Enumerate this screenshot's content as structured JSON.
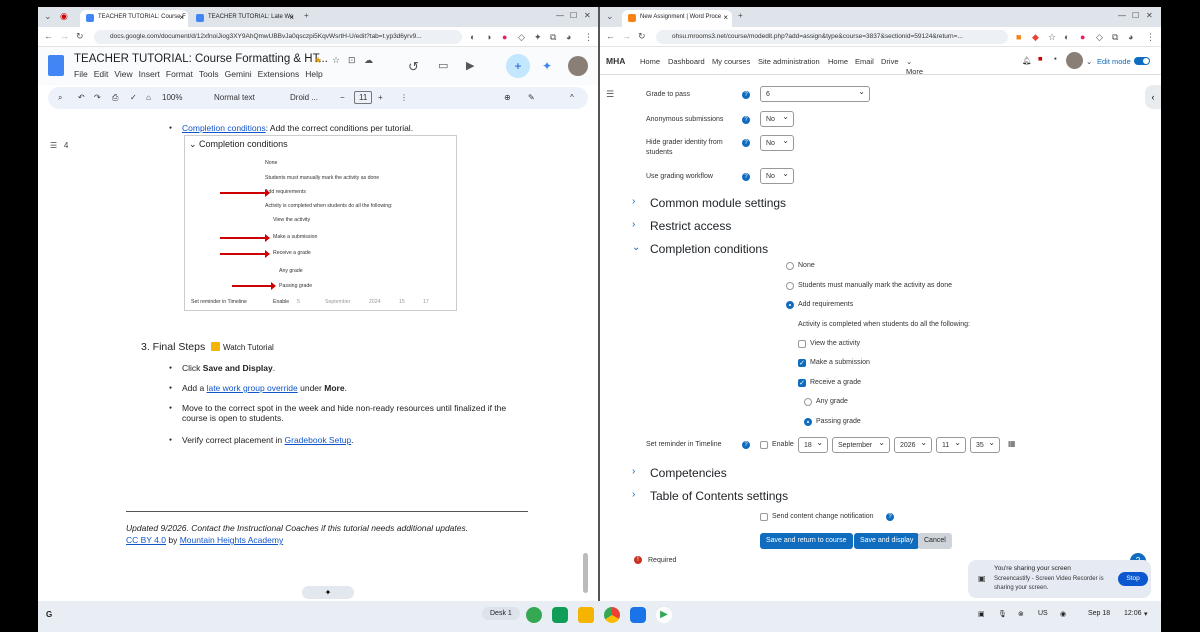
{
  "left_window": {
    "tabs": [
      "TEACHER TUTORIAL: Course F",
      "TEACHER TUTORIAL: Late Wo"
    ],
    "url": "docs.google.com/document/d/12xfnoiJiog3XY9AhQmwUBBvJa0qsczpi5KqvWsrtH-U/edit?tab=t.yp3d6yrv9...",
    "doc_title": "TEACHER TUTORIAL: Course Formatting & HT...",
    "menu": [
      "File",
      "Edit",
      "View",
      "Insert",
      "Format",
      "Tools",
      "Gemini",
      "Extensions",
      "Help"
    ],
    "toolbar": {
      "zoom": "100%",
      "style": "Normal text",
      "font": "Droid ...",
      "size": "11",
      "outline_count": "4"
    },
    "content": {
      "completion_link": "Completion conditions",
      "completion_text": ": Add the correct conditions per tutorial.",
      "shot": {
        "heading": "Completion conditions",
        "none": "None",
        "manual": "Students must manually mark the activity as done",
        "add": "Add requirements",
        "activity": "Activity is completed when students do all the following:",
        "view": "View the activity",
        "submit": "Make a submission",
        "grade": "Receive a grade",
        "any": "Any grade",
        "passing": "Passing grade",
        "reminder": "Set reminder in Timeline",
        "enable": "Enable",
        "d": "5",
        "m": "September",
        "y": "2024",
        "h": "15",
        "min": "17"
      },
      "step_heading": "3.  Final Steps",
      "watch": "Watch Tutorial",
      "b1_pre": "Click ",
      "b1_bold": "Save and Display",
      "b1_post": ".",
      "b2_pre": "Add a ",
      "b2_link": "late work group override",
      "b2_mid": " under ",
      "b2_bold": "More",
      "b2_post": ".",
      "b3_line1": "Move to the correct spot in the week and hide non-ready resources until finalized if the",
      "b3_line2": "course is open to students.",
      "b4_pre": "Verify correct placement in ",
      "b4_link": "Gradebook Setup",
      "b4_post": ".",
      "footer_italic": "Updated 9/2026. Contact the Instructional Coaches if this tutorial needs additional updates.",
      "footer_cc": "CC BY 4.0",
      "footer_by": " by ",
      "footer_org": "Mountain Heights Academy"
    }
  },
  "right_window": {
    "tab": "New Assignment | Word Proce",
    "url": "ohsu.mrooms3.net/course/modedit.php?add=assign&type&course=3837&sectionid=59124&return=...",
    "brand": "MHA",
    "nav": [
      "Home",
      "Dashboard",
      "My courses",
      "Site administration",
      "Home",
      "Email",
      "Drive",
      "More"
    ],
    "edit_mode": "Edit mode",
    "form": {
      "grade_to_pass_label": "Grade to pass",
      "grade_to_pass_value": "6",
      "anon_label": "Anonymous submissions",
      "anon_value": "No",
      "hide_label_1": "Hide grader identity from",
      "hide_label_2": "students",
      "hide_value": "No",
      "workflow_label": "Use grading workflow",
      "workflow_value": "No",
      "sections": [
        "Common module settings",
        "Restrict access",
        "Completion conditions",
        "Competencies",
        "Table of Contents settings"
      ],
      "opt_none": "None",
      "opt_manual": "Students must manually mark the activity as done",
      "opt_add": "Add requirements",
      "activity_text": "Activity is completed when students do all the following:",
      "view": "View the activity",
      "submission": "Make a submission",
      "receive": "Receive a grade",
      "any": "Any grade",
      "passing": "Passing grade",
      "reminder_label": "Set reminder in Timeline",
      "enable": "Enable",
      "day": "18",
      "month": "September",
      "year": "2026",
      "hour": "11",
      "minute": "35",
      "notify": "Send content change notification",
      "btn_return": "Save and return to course",
      "btn_display": "Save and display",
      "btn_cancel": "Cancel",
      "required": "Required"
    }
  },
  "toast": {
    "title": "You're sharing your screen",
    "body1": "Screencastify - Screen Video Recorder is",
    "body2": "sharing your screen.",
    "stop": "Stop"
  },
  "shelf": {
    "desk": "Desk 1",
    "locale": "US",
    "date": "Sep 18",
    "time": "12:06"
  }
}
